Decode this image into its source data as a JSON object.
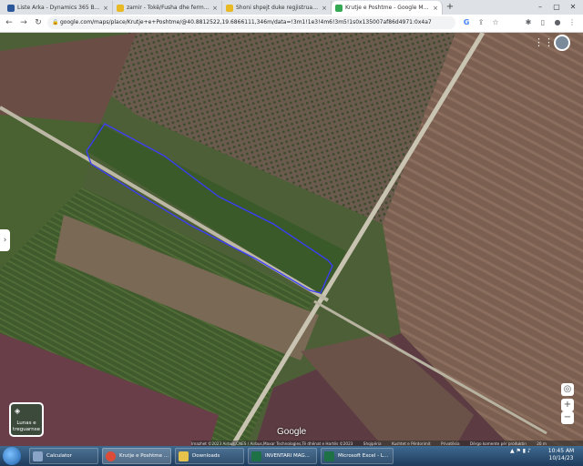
{
  "browser": {
    "tabs": [
      {
        "label": "Liste Arka - Dynamics 365 Busin",
        "favicon_color": "#2b579a",
        "close": "×"
      },
      {
        "label": "zamir - Tokë/Fusha dhe ferma Tir",
        "favicon_color": "#e8b923",
        "close": "×"
      },
      {
        "label": "Shoni shpejt duke regjistruar nje",
        "favicon_color": "#e8b923",
        "close": "×"
      },
      {
        "label": "Krutje e Poshtme - Google Maps",
        "favicon_color": "#34a853",
        "close": "×"
      }
    ],
    "new_tab": "+",
    "window_controls": {
      "minimize": "–",
      "maximize": "▢",
      "close": "✕"
    },
    "nav": {
      "back": "←",
      "forward": "→",
      "reload": "↻"
    },
    "url": "google.com/maps/place/Krutje+e+Poshtme/@40.8812522,19.6866111,346m/data=!3m1!1e3!4m6!3m5!1s0x135007af86d4971:0x4a7",
    "toolbar_icons": [
      "google-icon",
      "share-icon",
      "star-icon",
      "extensions-icon",
      "sidebar-icon",
      "profile-icon",
      "menu-icon"
    ]
  },
  "map": {
    "layers_label": "Lunas e treguarnse",
    "zoom_in": "+",
    "zoom_out": "−",
    "google_logo": "Google",
    "attribution": {
      "imagery": "Imazhet ©2023 Airbus,CNES / Airbus,Maxar Technologies,Të dhënat e Hartës ©2023",
      "country": "Shqipëria",
      "terms": "Kushtet e Përdorimit",
      "privacy": "Privatësia",
      "feedback": "Dërgo komente për produktin",
      "scale": "20 m"
    }
  },
  "taskbar": {
    "items": [
      {
        "label": "Calculator",
        "icon_color": "#8aa4c8"
      },
      {
        "label": "Krutje e Poshtme ...",
        "icon_color": "#dd4b39"
      },
      {
        "label": "Downloads",
        "icon_color": "#e6c34a"
      },
      {
        "label": "INVENTARI MAG...",
        "icon_color": "#1e7145"
      },
      {
        "label": "Microsoft Excel - L...",
        "icon_color": "#1e7145"
      }
    ],
    "time": "10:45 AM",
    "date": "10/14/23"
  }
}
